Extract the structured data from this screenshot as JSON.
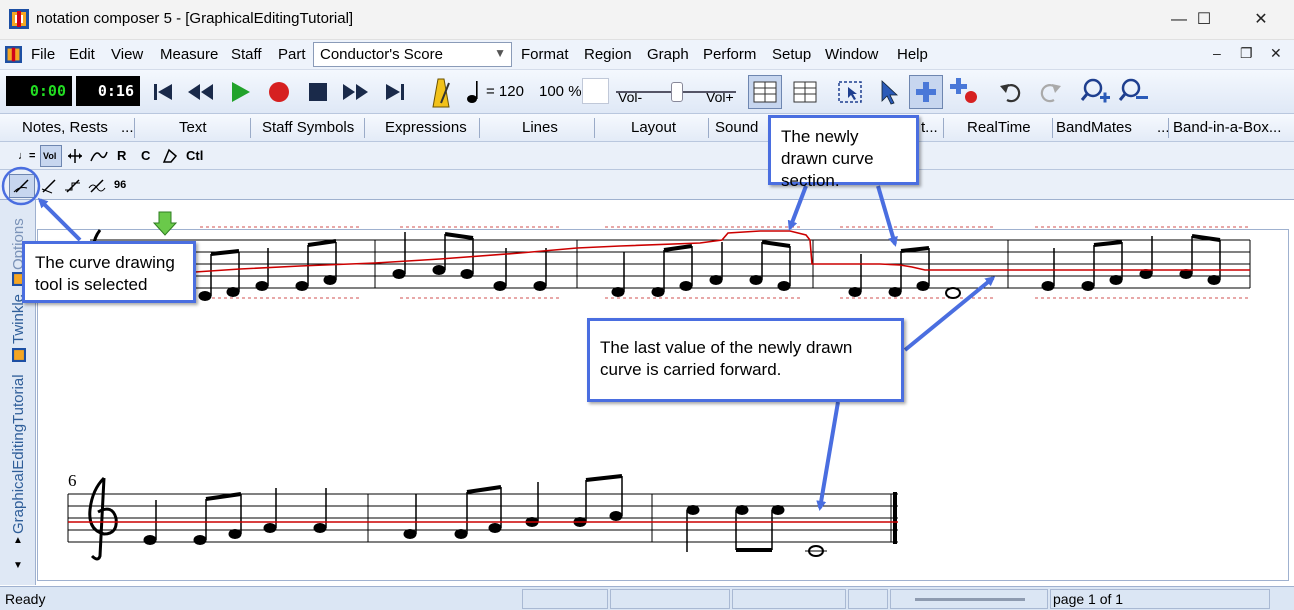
{
  "window": {
    "title": "notation composer 5 - [GraphicalEditingTutorial]",
    "minimize": "—",
    "maximize": "☐",
    "close": "✕"
  },
  "menu": {
    "file": "File",
    "edit": "Edit",
    "view": "View",
    "measure": "Measure",
    "staff": "Staff",
    "part": "Part",
    "score_select": "Conductor's Score",
    "format": "Format",
    "region": "Region",
    "graph": "Graph",
    "perform": "Perform",
    "setup": "Setup",
    "window": "Window",
    "help": "Help",
    "mdi_min": "–",
    "mdi_restore": "❐",
    "mdi_close": "✕"
  },
  "transport": {
    "time_current": "0:00",
    "time_total": "0:16",
    "time_current_color": "#22dd22",
    "time_total_color": "#ffffff",
    "tempo": "= 120",
    "zoom": "100 %",
    "vol_minus": "Vol-",
    "vol_plus": "Vol+"
  },
  "tabs": [
    "Notes, Rests",
    "...",
    "Text",
    "Staff Symbols",
    "Expressions",
    "Lines",
    "Layout",
    "Sound",
    "t...",
    "RealTime",
    "BandMates",
    "...",
    "Band-in-a-Box..."
  ],
  "graph_tools": {
    "tempo": "♩=",
    "vol": "Vol",
    "r": "R",
    "c": "C",
    "ctl": "Ctl",
    "num96": "96"
  },
  "sidebar": {
    "options": "Options",
    "twinkle": "Twinkle",
    "tutorial": "GraphicalEditingTutorial",
    "up": "▲",
    "down": "▼"
  },
  "score": {
    "measure_number": "6"
  },
  "callouts": {
    "curve_tool": "The curve drawing tool is selected",
    "new_section": "The newly drawn curve section.",
    "carried_forward": "The last value of the newly drawn curve is carried forward."
  },
  "status": {
    "ready": "Ready",
    "page": "page 1 of 1"
  },
  "colors": {
    "accent": "#4a6ee0",
    "curve": "#cc0000"
  }
}
